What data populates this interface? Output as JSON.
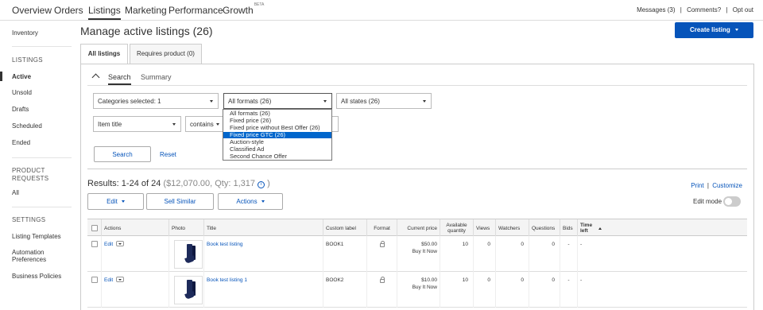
{
  "top_nav": {
    "tabs": [
      {
        "label": "Overview"
      },
      {
        "label": "Orders"
      },
      {
        "label": "Listings"
      },
      {
        "label": "Marketing"
      },
      {
        "label": "Performance"
      },
      {
        "label": "Growth",
        "badge": "BETA"
      }
    ],
    "active_tab": "Listings",
    "messages": "Messages (3)",
    "comments": "Comments?",
    "opt_out": "Opt out",
    "separator": "|"
  },
  "sidebar": {
    "inventory": "Inventory",
    "listings_header": "LISTINGS",
    "listings": [
      "Active",
      "Unsold",
      "Drafts",
      "Scheduled",
      "Ended"
    ],
    "active_item": "Active",
    "product_requests_header_1": "PRODUCT",
    "product_requests_header_2": "REQUESTS",
    "all": "All",
    "settings_header": "SETTINGS",
    "settings_items": [
      "Listing Templates",
      "Automation",
      "Preferences",
      "Business Policies"
    ]
  },
  "header": {
    "title": "Manage active listings (26)",
    "create_button": "Create listing"
  },
  "content_tabs": {
    "all_listings": "All listings",
    "requires_product": "Requires product (0)"
  },
  "search_tabs": {
    "search": "Search",
    "summary": "Summary"
  },
  "filters": {
    "categories": "Categories selected: 1",
    "formats": "All formats (26)",
    "states": "All states (26)",
    "field": "Item title",
    "operator": "contains"
  },
  "format_options": [
    "All formats (26)",
    "Fixed price (26)",
    "Fixed price without Best Offer (26)",
    "Fixed price GTC (26)",
    "Auction-style",
    "Classified Ad",
    "Second Chance Offer"
  ],
  "highlighted_option": "Fixed price GTC (26)",
  "search_button": "Search",
  "reset_link": "Reset",
  "results": {
    "label": "Results: 1-24 of 24",
    "summary": "($12,070.00, Qty: 1,317",
    "info_icon": "i",
    "close_paren": ")"
  },
  "print_link": "Print",
  "customize_link": "Customize",
  "actions_bar": {
    "edit": "Edit",
    "sell_similar": "Sell Similar",
    "actions": "Actions",
    "edit_mode": "Edit mode"
  },
  "table": {
    "columns": {
      "actions": "Actions",
      "photo": "Photo",
      "title": "Title",
      "custom_label": "Custom label",
      "format": "Format",
      "current_price": "Current price",
      "available_1": "Available",
      "available_2": "quantity",
      "views": "Views",
      "watchers": "Watchers",
      "questions": "Questions",
      "bids": "Bids",
      "time_left_1": "Time",
      "time_left_2": "left"
    },
    "rows": [
      {
        "edit": "Edit",
        "title": "Book test listing",
        "custom_label": "BOOK1",
        "price": "$50.00",
        "price_type": "Buy It Now",
        "quantity": "10",
        "views": "0",
        "watchers": "0",
        "questions": "0",
        "bids": "-",
        "time_left": "-"
      },
      {
        "edit": "Edit",
        "title": "Book test listing 1",
        "custom_label": "BOOK2",
        "price": "$10.00",
        "price_type": "Buy It Now",
        "quantity": "10",
        "views": "0",
        "watchers": "0",
        "questions": "0",
        "bids": "-",
        "time_left": "-"
      }
    ]
  },
  "colors": {
    "primary": "#0654ba",
    "dropdown_highlight": "#0066cc"
  }
}
